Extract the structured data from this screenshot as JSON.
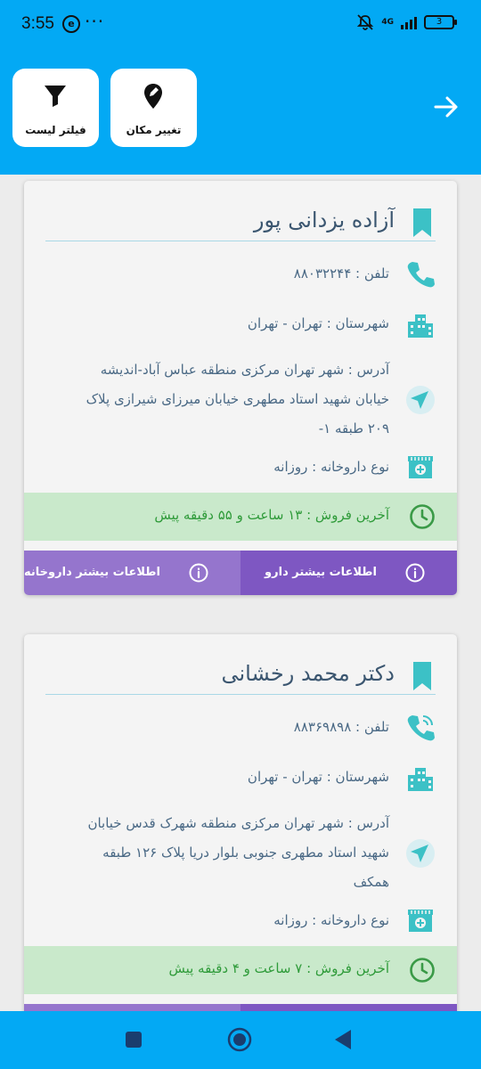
{
  "status_bar": {
    "time": "3:55",
    "network": "4G",
    "battery": "3",
    "app_icon": "e"
  },
  "header": {
    "filter_button": "فیلتر لیست",
    "location_button": "تغییر مکان"
  },
  "pharmacies": [
    {
      "name": "آزاده یزدانی پور",
      "phone": "تلفن : ۸۸۰۳۲۲۴۴",
      "city": "شهرستان : تهران - تهران",
      "address_lines": [
        "آدرس : شهر تهران مرکزی منطقه عباس آباد-اندیشه",
        "خیابان شهید استاد مطهری خیابان میرزای شیرازی پلاک",
        "۲۰۹ طبقه ۱-"
      ],
      "type": "نوع داروخانه : روزانه",
      "last_sale": "آخرین فروش : ۱۳ ساعت و ۵۵ دقیقه پیش",
      "more_drug": "اطلاعات بیشتر دارو",
      "more_pharmacy": "اطلاعات بیشتر داروخانه"
    },
    {
      "name": "دکتر محمد رخشانی",
      "phone": "تلفن : ۸۸۳۶۹۸۹۸",
      "city": "شهرستان : تهران - تهران",
      "address_lines": [
        "آدرس : شهر تهران مرکزی منطقه شهرک قدس خیابان",
        "شهید استاد مطهری جنوبی بلوار دریا پلاک ۱۲۶ طبقه",
        "همکف"
      ],
      "type": "نوع داروخانه : روزانه",
      "last_sale": "آخرین فروش : ۷ ساعت و ۴ دقیقه پیش"
    }
  ],
  "colors": {
    "primary": "#03a9f4",
    "accent": "#7e57c2",
    "sale_bg": "#c9e9cb",
    "sale_text": "#2f9b3a",
    "icon_teal": "#3cc1c6"
  }
}
